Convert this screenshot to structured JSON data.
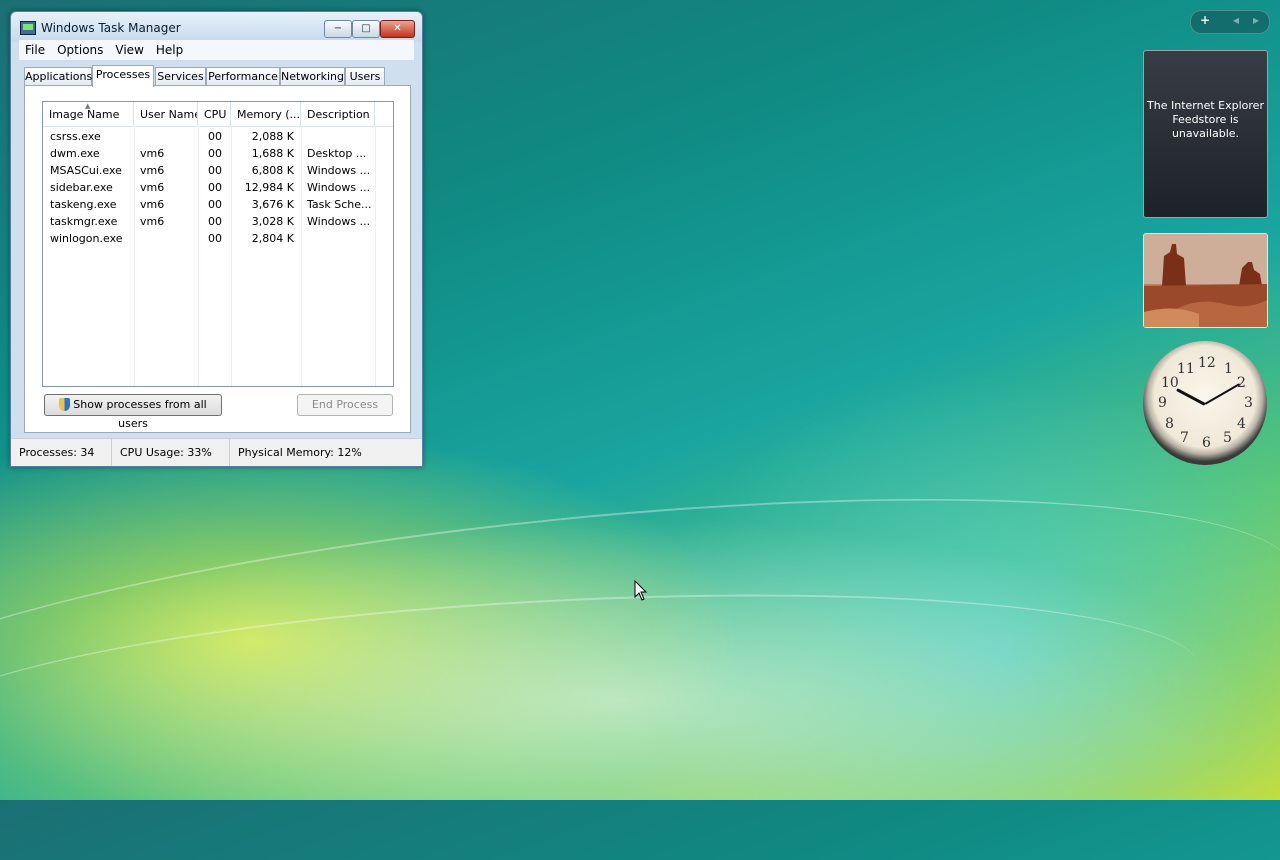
{
  "window": {
    "title": "Windows Task Manager",
    "controls": {
      "minimize": "−",
      "maximize": "□",
      "close": "✕"
    }
  },
  "menu": [
    "File",
    "Options",
    "View",
    "Help"
  ],
  "tabs": [
    {
      "label": "Applications"
    },
    {
      "label": "Processes",
      "active": true
    },
    {
      "label": "Services"
    },
    {
      "label": "Performance"
    },
    {
      "label": "Networking"
    },
    {
      "label": "Users"
    }
  ],
  "columns": [
    "Image Name",
    "User Name",
    "CPU",
    "Memory (...",
    "Description"
  ],
  "processes": [
    {
      "name": "csrss.exe",
      "user": "",
      "cpu": "00",
      "memory": "2,088 K",
      "description": ""
    },
    {
      "name": "dwm.exe",
      "user": "vm6",
      "cpu": "00",
      "memory": "1,688 K",
      "description": "Desktop ..."
    },
    {
      "name": "MSASCui.exe",
      "user": "vm6",
      "cpu": "00",
      "memory": "6,808 K",
      "description": "Windows ..."
    },
    {
      "name": "sidebar.exe",
      "user": "vm6",
      "cpu": "00",
      "memory": "12,984 K",
      "description": "Windows ..."
    },
    {
      "name": "taskeng.exe",
      "user": "vm6",
      "cpu": "00",
      "memory": "3,676 K",
      "description": "Task Sche..."
    },
    {
      "name": "taskmgr.exe",
      "user": "vm6",
      "cpu": "00",
      "memory": "3,028 K",
      "description": "Windows ..."
    },
    {
      "name": "winlogon.exe",
      "user": "",
      "cpu": "00",
      "memory": "2,804 K",
      "description": ""
    }
  ],
  "buttons": {
    "show_all": "Show processes from all users",
    "end_process": "End Process"
  },
  "status": {
    "processes": "Processes: 34",
    "cpu": "CPU Usage: 33%",
    "memory": "Physical Memory: 12%"
  },
  "sidebar": {
    "controls": {
      "add": "+",
      "prev": "◂",
      "next": "▸"
    },
    "feed_message": "The Internet Explorer Feedstore is unavailable.",
    "clock_numbers": [
      "12",
      "1",
      "2",
      "3",
      "4",
      "5",
      "6",
      "7",
      "8",
      "9",
      "10",
      "11"
    ]
  }
}
